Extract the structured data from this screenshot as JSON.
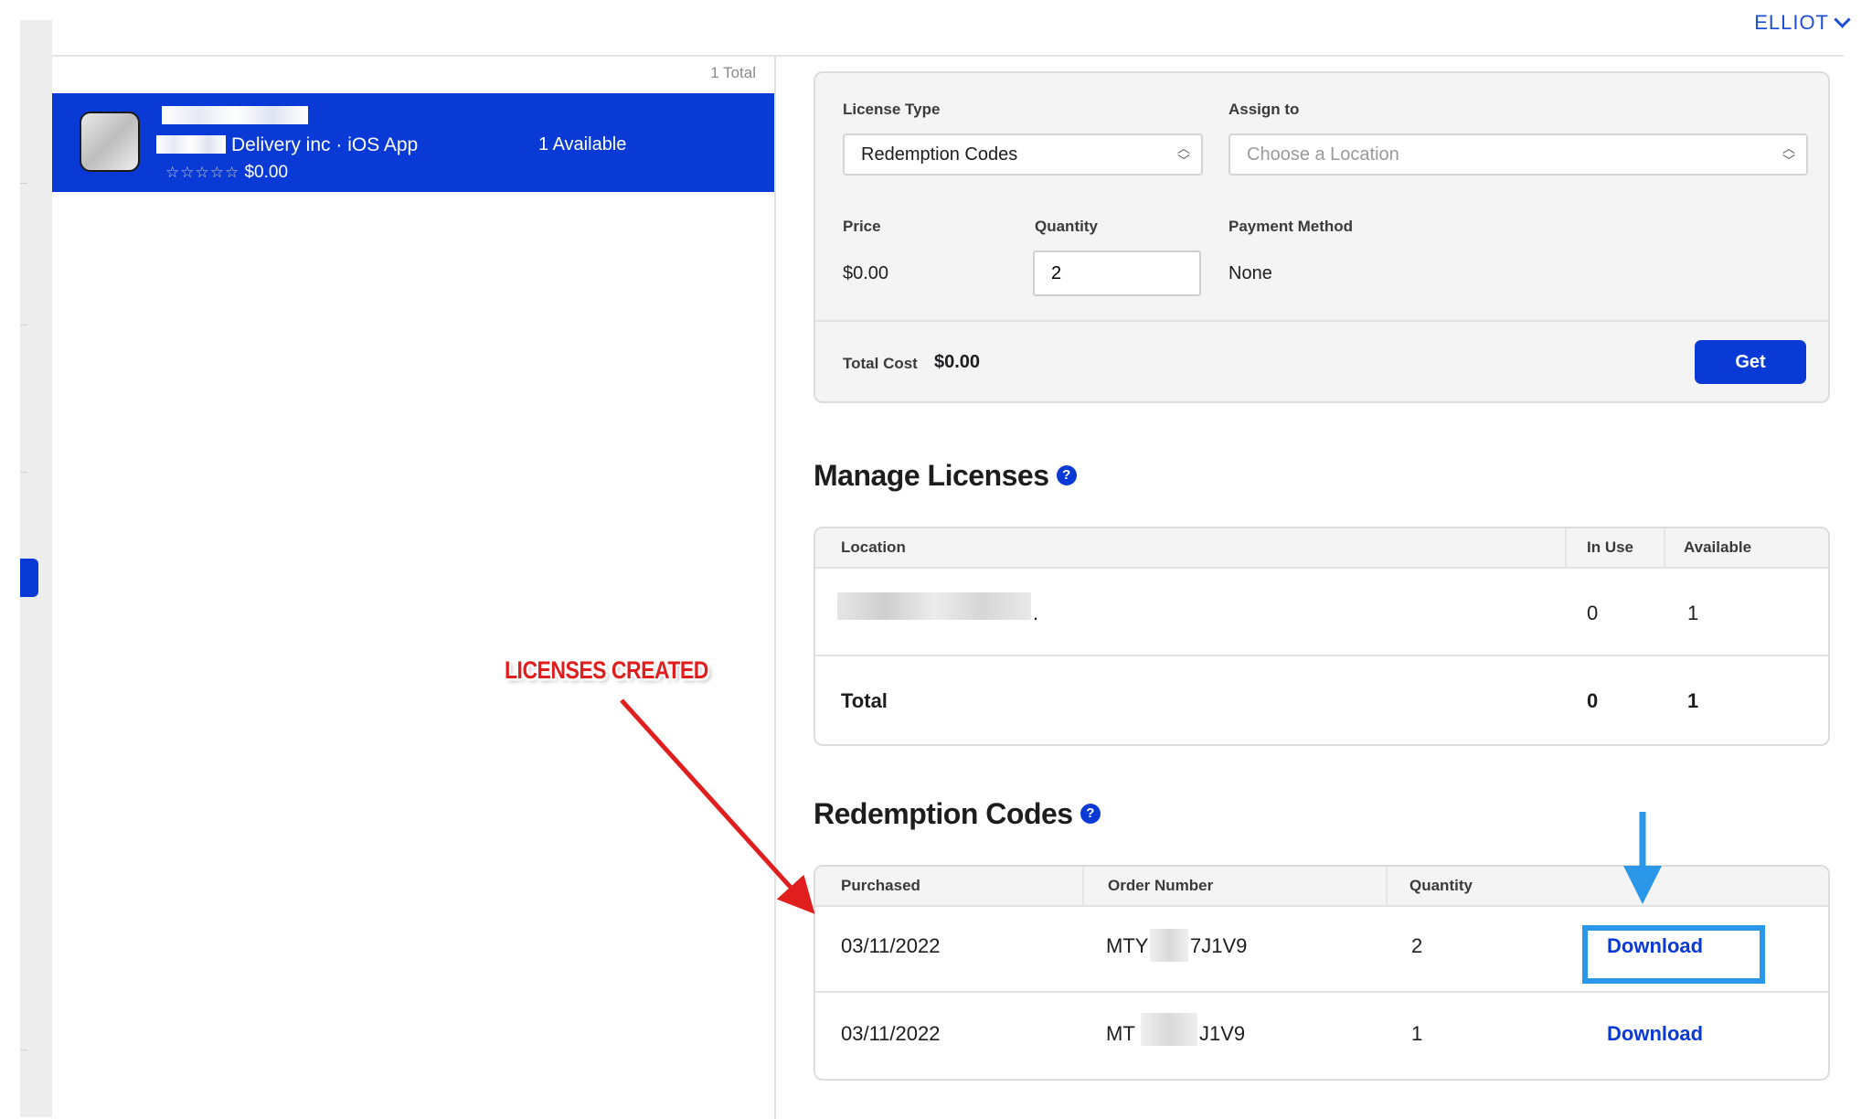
{
  "header": {
    "user_name": "ELLIOT"
  },
  "list": {
    "count_label": "1 Total",
    "app": {
      "developer_line": "Delivery inc · iOS App",
      "rating_stars": "☆☆☆☆☆",
      "price": "$0.00",
      "availability": "1 Available"
    }
  },
  "purchase": {
    "license_type_label": "License Type",
    "license_type_value": "Redemption Codes",
    "assign_to_label": "Assign to",
    "assign_to_placeholder": "Choose a Location",
    "price_label": "Price",
    "price_value": "$0.00",
    "quantity_label": "Quantity",
    "quantity_value": "2",
    "payment_label": "Payment Method",
    "payment_value": "None",
    "total_cost_label": "Total Cost",
    "total_cost_value": "$0.00",
    "get_label": "Get"
  },
  "manage_licenses": {
    "title": "Manage Licenses",
    "columns": [
      "Location",
      "In Use",
      "Available"
    ],
    "rows": [
      {
        "location_suffix": ".",
        "in_use": "0",
        "available": "1"
      }
    ],
    "total": {
      "label": "Total",
      "in_use": "0",
      "available": "1"
    }
  },
  "redemption_codes": {
    "title": "Redemption Codes",
    "columns": [
      "Purchased",
      "Order Number",
      "Quantity"
    ],
    "rows": [
      {
        "purchased": "03/11/2022",
        "order_prefix": "MTY",
        "order_suffix": "7J1V9",
        "quantity": "2",
        "action": "Download"
      },
      {
        "purchased": "03/11/2022",
        "order_prefix": "MT",
        "order_suffix": "J1V9",
        "quantity": "1",
        "action": "Download"
      }
    ]
  },
  "annotation": {
    "label": "LICENSES CREATED"
  },
  "colors": {
    "accent": "#0a3ad6",
    "annotation_red": "#e01e1e",
    "highlight_blue": "#2b97e8"
  },
  "icons": [
    "chevron-down-icon",
    "up-down-chevron-icon",
    "help-icon",
    "red-arrow",
    "blue-arrow"
  ]
}
